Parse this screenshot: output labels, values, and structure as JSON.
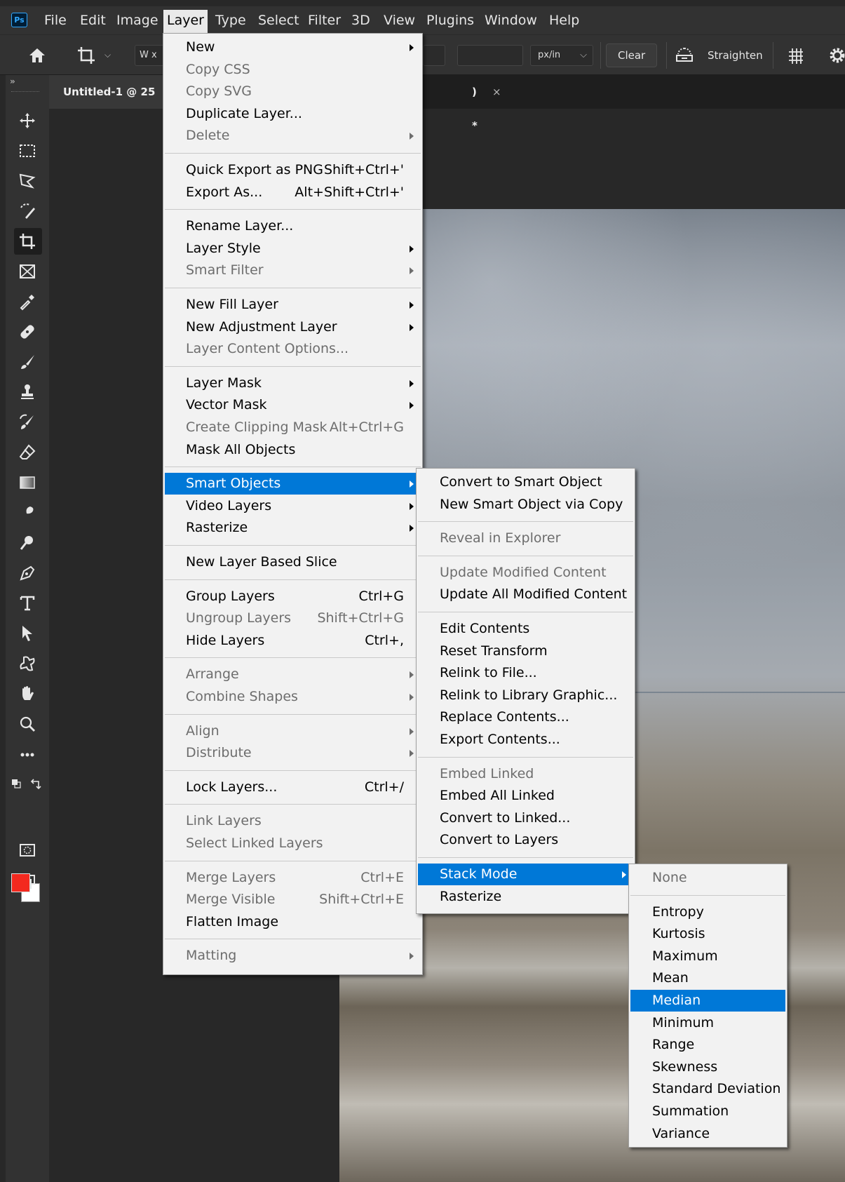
{
  "app": {
    "logo": "Ps"
  },
  "menubar": {
    "items": [
      "File",
      "Edit",
      "Image",
      "Layer",
      "Type",
      "Select",
      "Filter",
      "3D",
      "View",
      "Plugins",
      "Window",
      "Help"
    ]
  },
  "options_bar": {
    "ratio_field": "W x",
    "resolution_unit": "px/in",
    "clear_label": "Clear",
    "straighten_label": "Straighten"
  },
  "document_tab": {
    "title": "Untitled-1 @ 25",
    "suffix": ") *",
    "close": "×"
  },
  "toolbar": {
    "expand": "»"
  },
  "colors": {
    "foreground": "#f3291f",
    "background": "#ffffff",
    "highlight": "#0078d7"
  },
  "layer_menu": {
    "items": [
      {
        "label": "New",
        "submenu": true
      },
      {
        "label": "Copy CSS",
        "disabled": true
      },
      {
        "label": "Copy SVG",
        "disabled": true
      },
      {
        "label": "Duplicate Layer..."
      },
      {
        "label": "Delete",
        "disabled": true,
        "submenu": true
      },
      {
        "separator": true
      },
      {
        "label": "Quick Export as PNG",
        "shortcut": "Shift+Ctrl+'"
      },
      {
        "label": "Export As...",
        "shortcut": "Alt+Shift+Ctrl+'"
      },
      {
        "separator": true
      },
      {
        "label": "Rename Layer..."
      },
      {
        "label": "Layer Style",
        "submenu": true
      },
      {
        "label": "Smart Filter",
        "disabled": true,
        "submenu": true
      },
      {
        "separator": true
      },
      {
        "label": "New Fill Layer",
        "submenu": true
      },
      {
        "label": "New Adjustment Layer",
        "submenu": true
      },
      {
        "label": "Layer Content Options...",
        "disabled": true
      },
      {
        "separator": true
      },
      {
        "label": "Layer Mask",
        "submenu": true
      },
      {
        "label": "Vector Mask",
        "submenu": true
      },
      {
        "label": "Create Clipping Mask",
        "shortcut": "Alt+Ctrl+G",
        "disabled": true
      },
      {
        "label": "Mask All Objects"
      },
      {
        "separator": true
      },
      {
        "label": "Smart Objects",
        "submenu": true,
        "highlight": true
      },
      {
        "label": "Video Layers",
        "submenu": true
      },
      {
        "label": "Rasterize",
        "submenu": true
      },
      {
        "separator": true
      },
      {
        "label": "New Layer Based Slice"
      },
      {
        "separator": true
      },
      {
        "label": "Group Layers",
        "shortcut": "Ctrl+G"
      },
      {
        "label": "Ungroup Layers",
        "shortcut": "Shift+Ctrl+G",
        "disabled": true
      },
      {
        "label": "Hide Layers",
        "shortcut": "Ctrl+,"
      },
      {
        "separator": true
      },
      {
        "label": "Arrange",
        "disabled": true,
        "submenu": true
      },
      {
        "label": "Combine Shapes",
        "disabled": true,
        "submenu": true
      },
      {
        "separator": true
      },
      {
        "label": "Align",
        "disabled": true,
        "submenu": true
      },
      {
        "label": "Distribute",
        "disabled": true,
        "submenu": true
      },
      {
        "separator": true
      },
      {
        "label": "Lock Layers...",
        "shortcut": "Ctrl+/"
      },
      {
        "separator": true
      },
      {
        "label": "Link Layers",
        "disabled": true
      },
      {
        "label": "Select Linked Layers",
        "disabled": true
      },
      {
        "separator": true
      },
      {
        "label": "Merge Layers",
        "shortcut": "Ctrl+E",
        "disabled": true
      },
      {
        "label": "Merge Visible",
        "shortcut": "Shift+Ctrl+E",
        "disabled": true
      },
      {
        "label": "Flatten Image"
      },
      {
        "separator": true
      },
      {
        "label": "Matting",
        "disabled": true,
        "submenu": true
      }
    ]
  },
  "smart_objects_menu": {
    "items": [
      {
        "label": "Convert to Smart Object"
      },
      {
        "label": "New Smart Object via Copy"
      },
      {
        "separator": true
      },
      {
        "label": "Reveal in Explorer",
        "disabled": true
      },
      {
        "separator": true
      },
      {
        "label": "Update Modified Content",
        "disabled": true
      },
      {
        "label": "Update All Modified Content"
      },
      {
        "separator": true
      },
      {
        "label": "Edit Contents"
      },
      {
        "label": "Reset Transform"
      },
      {
        "label": "Relink to File..."
      },
      {
        "label": "Relink to Library Graphic..."
      },
      {
        "label": "Replace Contents..."
      },
      {
        "label": "Export Contents..."
      },
      {
        "separator": true
      },
      {
        "label": "Embed Linked",
        "disabled": true
      },
      {
        "label": "Embed All Linked"
      },
      {
        "label": "Convert to Linked..."
      },
      {
        "label": "Convert to Layers"
      },
      {
        "separator": true
      },
      {
        "label": "Stack Mode",
        "submenu": true,
        "highlight": true
      },
      {
        "label": "Rasterize"
      }
    ]
  },
  "stack_mode_menu": {
    "items": [
      {
        "label": "None",
        "disabled": true
      },
      {
        "separator": true
      },
      {
        "label": "Entropy"
      },
      {
        "label": "Kurtosis"
      },
      {
        "label": "Maximum"
      },
      {
        "label": "Mean"
      },
      {
        "label": "Median",
        "highlight": true
      },
      {
        "label": "Minimum"
      },
      {
        "label": "Range"
      },
      {
        "label": "Skewness"
      },
      {
        "label": "Standard Deviation"
      },
      {
        "label": "Summation"
      },
      {
        "label": "Variance"
      }
    ]
  }
}
